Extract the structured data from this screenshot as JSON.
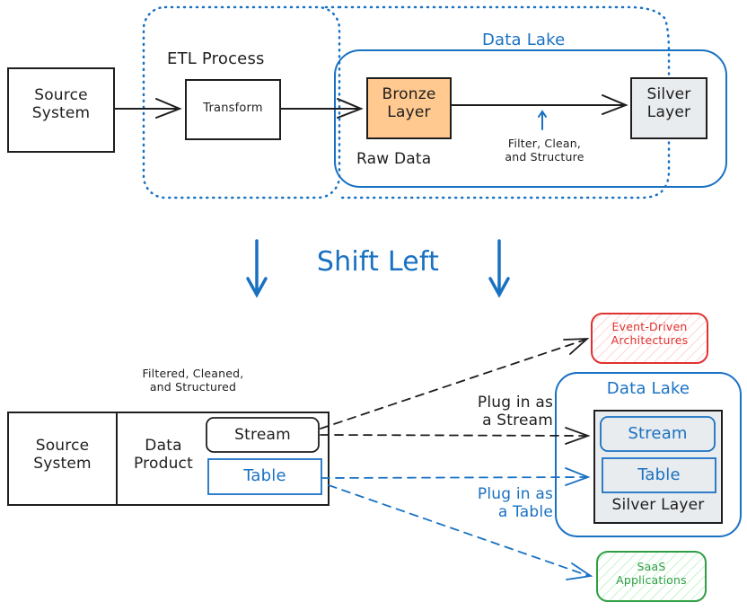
{
  "colors": {
    "ink": "#1e1e1e",
    "blue": "#1971c2",
    "bronze_fill": "#ffc98f",
    "silver_fill": "#e9ecef",
    "red": "#e03131",
    "green": "#2f9e44"
  },
  "top": {
    "etl_label": "ETL Process",
    "data_lake_label": "Data Lake",
    "source_system": "Source System",
    "source_line1": "Source",
    "source_line2": "System",
    "transform": "Transform",
    "bronze_line1": "Bronze",
    "bronze_line2": "Layer",
    "raw_data": "Raw Data",
    "silver_line1": "Silver",
    "silver_line2": "Layer",
    "filter_line1": "Filter, Clean,",
    "filter_line2": "and Structure"
  },
  "middle": {
    "title": "Shift Left"
  },
  "bottom": {
    "filtered_line1": "Filtered, Cleaned,",
    "filtered_line2": "and Structured",
    "source_line1": "Source",
    "source_line2": "System",
    "product_line1": "Data",
    "product_line2": "Product",
    "stream": "Stream",
    "table": "Table",
    "plug_stream_line1": "Plug in as",
    "plug_stream_line2": "a Stream",
    "plug_table_line1": "Plug in as",
    "plug_table_line2": "a Table",
    "event_line1": "Event-Driven",
    "event_line2": "Architectures",
    "lake_label": "Data Lake",
    "lake_stream": "Stream",
    "lake_table": "Table",
    "silver_layer": "Silver Layer",
    "saas_line1": "SaaS",
    "saas_line2": "Applications"
  }
}
